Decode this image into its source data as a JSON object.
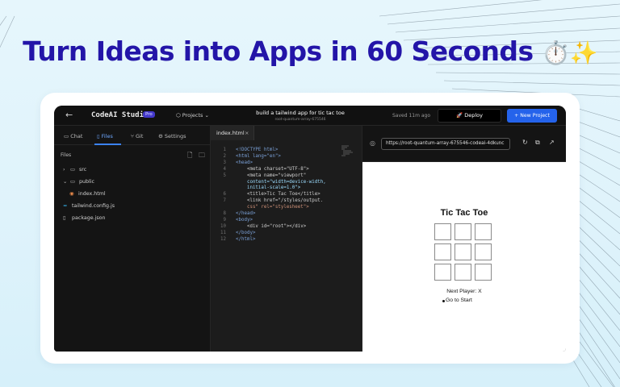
{
  "headline": {
    "text": "Turn Ideas into Apps in 60 Seconds",
    "emoji": "⏱️✨"
  },
  "topbar": {
    "back_icon": "←",
    "brand": "CodeAI Studio",
    "badge": "Pro",
    "projects_label": "Projects",
    "project_title": "build a tailwind app for tic tac toe",
    "project_id": "root-quantum-array-675546",
    "saved_status": "Saved 11m ago",
    "deploy_label": "Deploy",
    "new_project_label": "+ New Project"
  },
  "sidebar": {
    "tabs": [
      {
        "label": "Chat",
        "icon": "chat-icon"
      },
      {
        "label": "Files",
        "icon": "file-icon"
      },
      {
        "label": "Git",
        "icon": "git-icon"
      },
      {
        "label": "Settings",
        "icon": "gear-icon"
      }
    ],
    "active_tab": "Files",
    "files_heading": "Files",
    "tree": [
      {
        "name": "src",
        "type": "folder",
        "expanded": false
      },
      {
        "name": "public",
        "type": "folder",
        "expanded": true
      },
      {
        "name": "index.html",
        "type": "html-file"
      },
      {
        "name": "tailwind.config.js",
        "type": "config-file"
      },
      {
        "name": "package.json",
        "type": "file"
      }
    ]
  },
  "editor": {
    "tab_label": "index.html",
    "close_icon": "×",
    "line_numbers": [
      "1",
      "2",
      "3",
      "4",
      "5",
      "",
      "6",
      "7",
      "",
      "8",
      "9",
      "10",
      "11",
      "12"
    ],
    "lines": [
      "<!DOCTYPE html>",
      "<html lang=\"en\">",
      "<head>",
      "    <meta charset=\"UTF-8\">",
      "    <meta name=\"viewport\"",
      "    content=\"width=device-width,",
      "    initial-scale=1.0\">",
      "    <title>Tic Tac Toe</title>",
      "    <link href=\"/styles/output.",
      "    css\" rel=\"stylesheet\">",
      "</head>",
      "<body>",
      "    <div id=\"root\"></div>",
      "</body>",
      "</html>"
    ]
  },
  "preview": {
    "url": "https://root-quantum-array-675546-codeai-4dkunc",
    "title": "Tic Tac Toe",
    "board": [
      "",
      "",
      "",
      "",
      "",
      "",
      "",
      "",
      ""
    ],
    "next_player": "Next Player: X",
    "goto_start": "Go to Start"
  },
  "colors": {
    "headline": "#2315a8",
    "background": "#e2f5fb",
    "app_bg": "#141414",
    "accent": "#2563eb",
    "active_tab": "#6ea8ff"
  }
}
